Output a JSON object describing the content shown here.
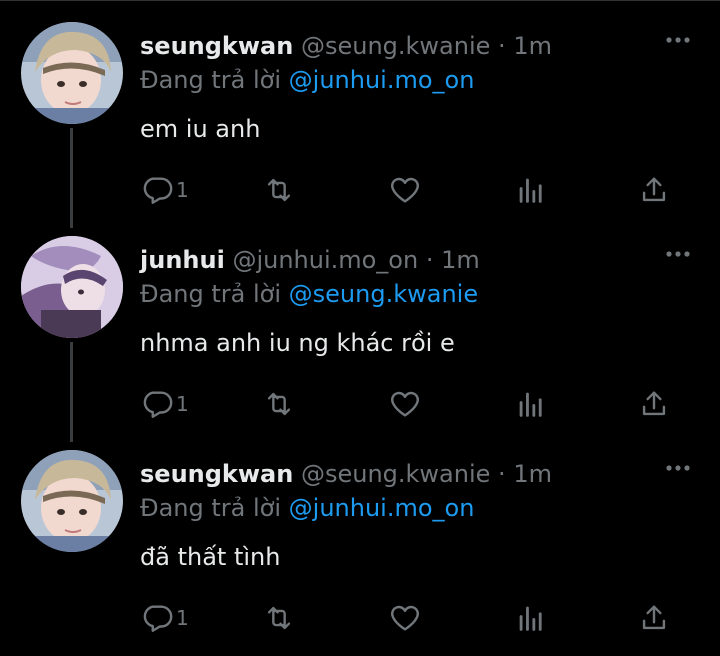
{
  "tweets": [
    {
      "name": "seungkwan",
      "handle": "@seung.kwanie",
      "sep": "·",
      "time": "1m",
      "reply_prefix": "Đang trả lời",
      "reply_to": "@junhui.mo_on",
      "text": "em iu anh",
      "reply_count": "1",
      "avatar": "seungkwan-avatar"
    },
    {
      "name": "junhui",
      "handle": "@junhui.mo_on",
      "sep": "·",
      "time": "1m",
      "reply_prefix": "Đang trả lời",
      "reply_to": "@seung.kwanie",
      "text": "nhma anh iu ng khác rồi e",
      "reply_count": "1",
      "avatar": "junhui-avatar"
    },
    {
      "name": "seungkwan",
      "handle": "@seung.kwanie",
      "sep": "·",
      "time": "1m",
      "reply_prefix": "Đang trả lời",
      "reply_to": "@junhui.mo_on",
      "text": "đã thất tình",
      "reply_count": "1",
      "avatar": "seungkwan-avatar"
    }
  ],
  "colors": {
    "background": "#000000",
    "primary_text": "#e7e9ea",
    "secondary_text": "#71767b",
    "mention": "#1d9bf0"
  },
  "icons": [
    "more-icon",
    "reply-icon",
    "retweet-icon",
    "like-icon",
    "views-icon",
    "share-icon"
  ]
}
